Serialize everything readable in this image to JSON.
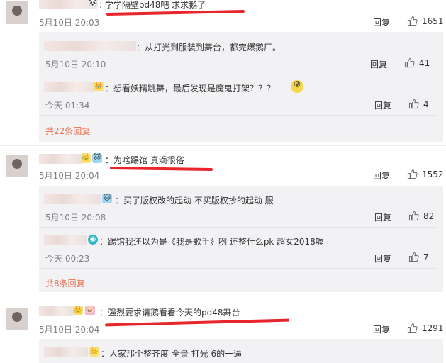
{
  "icons": {
    "like": "thumbs-up-icon",
    "emoji": "emoji-icon"
  },
  "colors": {
    "accent": "#eb7350",
    "annotation": "#e8252b"
  },
  "threads": [
    {
      "text": ": 学学隔壁pd48吧 求求鹅了",
      "time": "5月10日 20:03",
      "reply_label": "回复",
      "likes": "1651",
      "replies": [
        {
          "text": "：从打光到服装到舞台，都完爆鹅厂。",
          "time": "5月10日 20:10",
          "reply_label": "回复",
          "likes": "41"
        },
        {
          "text": "：想看妖精跳舞，最后发现是魔鬼打架？？？",
          "time": "今天 01:34",
          "reply_label": "回复",
          "likes": "4"
        }
      ],
      "more": "共22条回复"
    },
    {
      "text": "：为啥踢馆 真滴很俗",
      "time": "5月10日 20:04",
      "reply_label": "回复",
      "likes": "1552",
      "replies": [
        {
          "text": "：买了版权改的起动 不买版权抄的起动 服",
          "time": "5月10日 20:08",
          "reply_label": "回复",
          "likes": "82"
        },
        {
          "text": "：踢馆我还以为是《我是歌手》咧 还整什么pk 超女2018喔",
          "time": "今天 00:23",
          "reply_label": "回复",
          "likes": "7"
        }
      ],
      "more": "共8条回复"
    },
    {
      "text": "：强烈要求请鹅看看今天的pd48舞台",
      "time": "5月10日 20:04",
      "reply_label": "回复",
      "likes": "1291",
      "replies": [
        {
          "text": "：人家那个整齐度 全景 打光 6的一逼"
        }
      ]
    }
  ]
}
